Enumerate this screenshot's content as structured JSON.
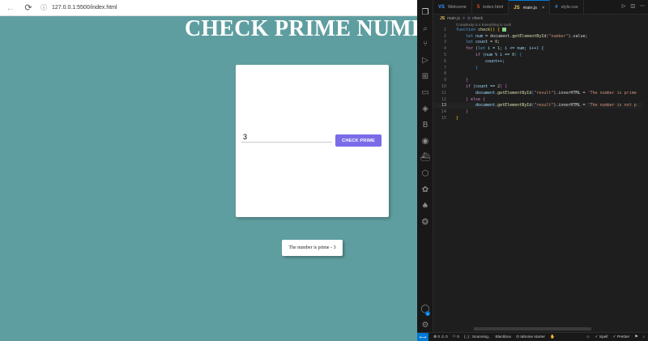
{
  "browser": {
    "url": "127.0.0.1:5500/index.html",
    "page_title": "CHECK PRIME NUMBER",
    "input_value": "3",
    "button_label": "CHECK PRIME",
    "result_text": "The number is prime - 3"
  },
  "vscode": {
    "tabs": [
      {
        "label": "Welcome",
        "icon": "VS"
      },
      {
        "label": "index.html",
        "icon": "5"
      },
      {
        "label": "main.js",
        "icon": "JS"
      },
      {
        "label": "style.css",
        "icon": "#"
      }
    ],
    "tab_close": "×",
    "breadcrumb": {
      "file": "main.js",
      "separator": ">",
      "symbol": "check"
    },
    "codelens": "Complexity is 4 Everything is cool!",
    "line_numbers": [
      "1",
      "2",
      "3",
      "4",
      "5",
      "6",
      "7",
      "8",
      "9",
      "10",
      "11",
      "12",
      "13",
      "14",
      "15"
    ],
    "code": {
      "l1_kw": "function",
      "l1_fn": "check",
      "l1_rest": "() {",
      "l2_kw": "let",
      "l2_var": "num",
      "l2_mid": " = document.",
      "l2_fn": "getElementById",
      "l2_open": "(",
      "l2_str": "\"number\"",
      "l2_close": ").value;",
      "l3_kw": "let",
      "l3_var": "count",
      "l3_mid": " = ",
      "l3_num": "0",
      "l3_end": ";",
      "l4_kw": "for",
      "l4_a": " (",
      "l4_let": "let",
      "l4_b": " i = ",
      "l4_n1": "1",
      "l4_c": "; i <= num; i++) {",
      "l5_kw": "if",
      "l5_a": " (num % i == ",
      "l5_n": "0",
      "l5_b": ") {",
      "l6": "count++;",
      "l7": "}",
      "l9": "}",
      "l10_kw": "if",
      "l10_a": " (count == ",
      "l10_n": "2",
      "l10_b": ") {",
      "l11_a": "document.",
      "l11_fn": "getElementById",
      "l11_b": "(",
      "l11_str": "\"result\"",
      "l11_c": ").innerHTML = ",
      "l11_str2": "'The number is prime",
      "l12_a": "} ",
      "l12_kw": "else",
      "l12_b": " {",
      "l13_a": "document.",
      "l13_fn": "getElementById",
      "l13_b": "(",
      "l13_str": "\"result\"",
      "l13_c": ").innerHTML = ",
      "l13_str2": "'The number is not p",
      "l14": "}",
      "l15": "}"
    },
    "status": {
      "errors": "⊗ 0 ⚠ 0",
      "ports": "0",
      "scanning": "{..} : Scanning..",
      "blackbox": "Blackbox",
      "tabnine": "⊙ tabnine starter",
      "spell": "✓ Spell",
      "prettier": "✓ Prettier",
      "account_badge": "1"
    }
  }
}
